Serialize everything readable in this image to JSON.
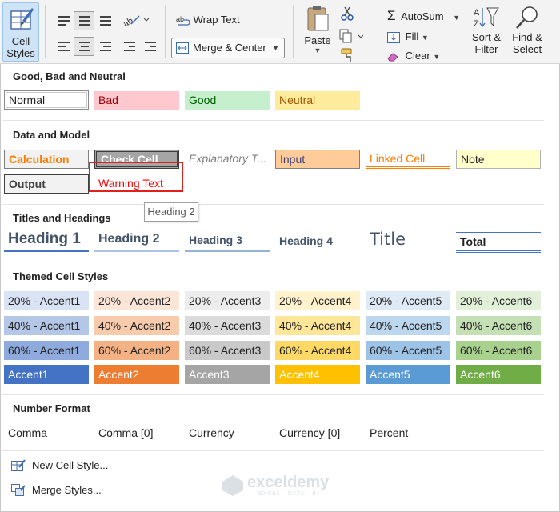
{
  "ribbon": {
    "cell_styles": "Cell\nStyles",
    "wrap_text": "Wrap Text",
    "merge_center": "Merge & Center",
    "paste": "Paste",
    "autosum": "AutoSum",
    "fill": "Fill",
    "clear": "Clear",
    "sort_filter": "Sort &\nFilter",
    "find_select": "Find &\nSelect"
  },
  "sections": {
    "good_bad": "Good, Bad and Neutral",
    "data_model": "Data and Model",
    "titles": "Titles and Headings",
    "themed": "Themed Cell Styles",
    "number": "Number Format"
  },
  "good_bad_styles": [
    "Normal",
    "Bad",
    "Good",
    "Neutral"
  ],
  "data_model_styles": [
    "Calculation",
    "Check Cell",
    "Explanatory T...",
    "Input",
    "Linked Cell",
    "Note",
    "Output",
    "Warning Text"
  ],
  "title_styles": [
    "Heading 1",
    "Heading 2",
    "Heading 3",
    "Heading 4",
    "Title",
    "Total"
  ],
  "tooltip": "Heading 2",
  "themed": {
    "row20": [
      "20% - Accent1",
      "20% - Accent2",
      "20% - Accent3",
      "20% - Accent4",
      "20% - Accent5",
      "20% - Accent6"
    ],
    "row40": [
      "40% - Accent1",
      "40% - Accent2",
      "40% - Accent3",
      "40% - Accent4",
      "40% - Accent5",
      "40% - Accent6"
    ],
    "row60": [
      "60% - Accent1",
      "60% - Accent2",
      "60% - Accent3",
      "60% - Accent4",
      "60% - Accent5",
      "60% - Accent6"
    ],
    "row100": [
      "Accent1",
      "Accent2",
      "Accent3",
      "Accent4",
      "Accent5",
      "Accent6"
    ]
  },
  "themed_colors": {
    "row20": [
      "#dae3f3",
      "#fbe5d6",
      "#ededed",
      "#fff2cc",
      "#deebf7",
      "#e2f0d9"
    ],
    "row40": [
      "#b4c7e7",
      "#f8cbad",
      "#dbdbdb",
      "#ffe699",
      "#bdd7ee",
      "#c5e0b4"
    ],
    "row60": [
      "#8faadc",
      "#f4b183",
      "#c9c9c9",
      "#ffd966",
      "#9dc3e6",
      "#a9d18e"
    ],
    "row100": [
      "#4472c4",
      "#ed7d31",
      "#a5a5a5",
      "#ffc000",
      "#5b9bd5",
      "#70ad47"
    ]
  },
  "number_format": [
    "Comma",
    "Comma [0]",
    "Currency",
    "Currency [0]",
    "Percent"
  ],
  "menu": {
    "new_cell_style": "New Cell Style...",
    "merge_styles": "Merge Styles..."
  },
  "watermark": {
    "name": "exceldemy",
    "sub": "EXCEL · DATA · BI"
  }
}
